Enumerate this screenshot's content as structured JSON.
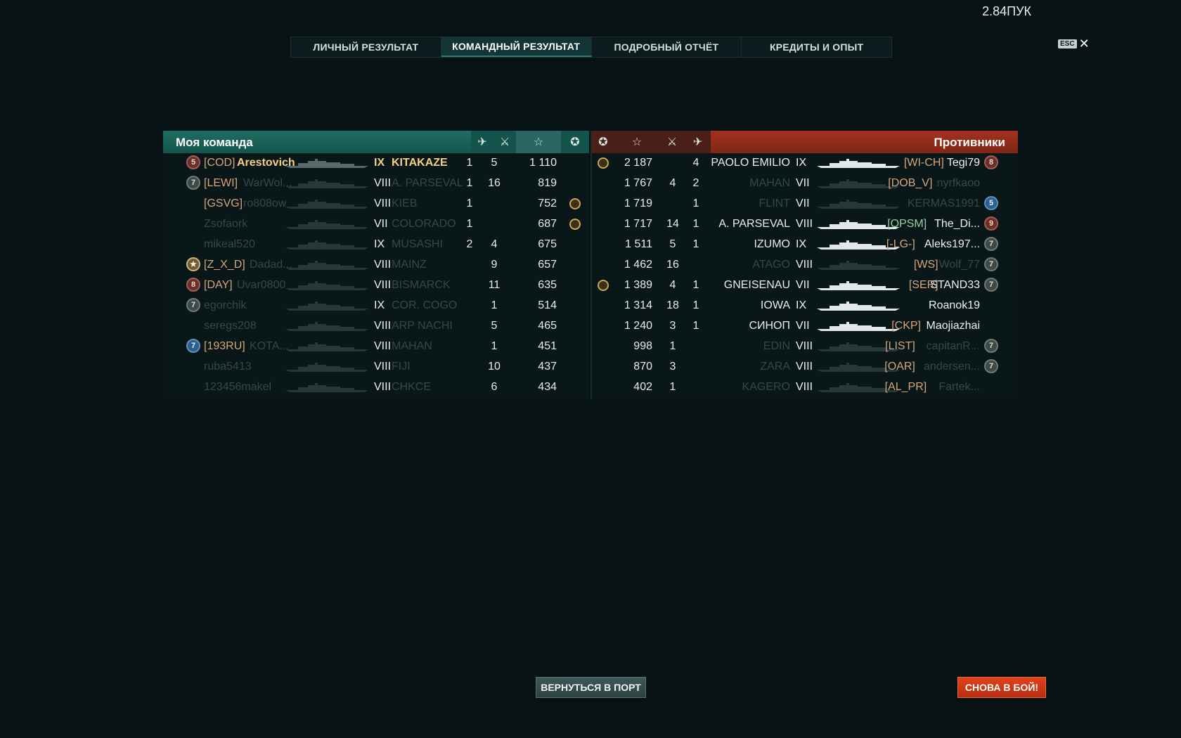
{
  "top_info": "2.84ПУК",
  "tabs": [
    {
      "label": "ЛИЧНЫЙ РЕЗУЛЬТАТ",
      "active": false
    },
    {
      "label": "КОМАНДНЫЙ РЕЗУЛЬТАТ",
      "active": true
    },
    {
      "label": "ПОДРОБНЫЙ ОТЧЁТ",
      "active": false
    },
    {
      "label": "КРЕДИТЫ И ОПЫТ",
      "active": false
    }
  ],
  "esc_label": "ESC",
  "close_glyph": "✕",
  "my_team": {
    "title": "Моя команда",
    "header_icons": {
      "planes": "✈",
      "kills": "⚔",
      "exp": "☆",
      "medal": "✪"
    },
    "rows": [
      {
        "badge": "5",
        "badge_style": "red",
        "clan": "[COD]",
        "name": "Arestovich",
        "tier": "IX",
        "ship": "KITAKAZE",
        "planes": "1",
        "kills": "5",
        "exp": "1 110",
        "medal": false,
        "me": true,
        "dim": false
      },
      {
        "badge": "7",
        "badge_style": "gray",
        "clan": "[LEWI]",
        "name": "WarWol...",
        "tier": "VIII",
        "ship": "A. PARSEVAL",
        "planes": "1",
        "kills": "16",
        "exp": "819",
        "medal": false,
        "me": false,
        "dim": true
      },
      {
        "badge": "",
        "badge_style": "",
        "clan": "[GSVG]",
        "name": "ro808ow",
        "tier": "VIII",
        "ship": "KIEB",
        "planes": "1",
        "kills": "",
        "exp": "752",
        "medal": true,
        "me": false,
        "dim": true
      },
      {
        "badge": "",
        "badge_style": "",
        "clan": "",
        "name": "Zsofaork",
        "tier": "VII",
        "ship": "COLORADO",
        "planes": "1",
        "kills": "",
        "exp": "687",
        "medal": true,
        "me": false,
        "dim": true
      },
      {
        "badge": "",
        "badge_style": "",
        "clan": "",
        "name": "mikeal520",
        "tier": "IX",
        "ship": "MUSASHI",
        "planes": "2",
        "kills": "4",
        "exp": "675",
        "medal": false,
        "me": false,
        "dim": true
      },
      {
        "badge": "★",
        "badge_style": "star",
        "clan": "[Z_X_D]",
        "name": "Dadad...",
        "tier": "VIII",
        "ship": "MAINZ",
        "planes": "",
        "kills": "9",
        "exp": "657",
        "medal": false,
        "me": false,
        "dim": true
      },
      {
        "badge": "8",
        "badge_style": "red",
        "clan": "[DAY]",
        "name": "Uvar0800",
        "tier": "VIII",
        "ship": "BISMARCK",
        "planes": "",
        "kills": "11",
        "exp": "635",
        "medal": false,
        "me": false,
        "dim": true
      },
      {
        "badge": "7",
        "badge_style": "gray",
        "clan": "",
        "name": "egorchik",
        "tier": "IX",
        "ship": "COR. COGO",
        "planes": "",
        "kills": "1",
        "exp": "514",
        "medal": false,
        "me": false,
        "dim": true
      },
      {
        "badge": "",
        "badge_style": "",
        "clan": "",
        "name": "seregs208",
        "tier": "VIII",
        "ship": "ARP NACHI",
        "planes": "",
        "kills": "5",
        "exp": "465",
        "medal": false,
        "me": false,
        "dim": true
      },
      {
        "badge": "7",
        "badge_style": "blue",
        "clan": "[193RU]",
        "name": "KOTA...",
        "tier": "VIII",
        "ship": "MAHAN",
        "planes": "",
        "kills": "1",
        "exp": "451",
        "medal": false,
        "me": false,
        "dim": true
      },
      {
        "badge": "",
        "badge_style": "",
        "clan": "",
        "name": "ruba5413",
        "tier": "VIII",
        "ship": "FIJI",
        "planes": "",
        "kills": "10",
        "exp": "437",
        "medal": false,
        "me": false,
        "dim": true
      },
      {
        "badge": "",
        "badge_style": "",
        "clan": "",
        "name": "123456makel",
        "tier": "VIII",
        "ship": "CHKCE",
        "planes": "",
        "kills": "6",
        "exp": "434",
        "medal": false,
        "me": false,
        "dim": true
      }
    ]
  },
  "enemy_team": {
    "title": "Противники",
    "rows": [
      {
        "medal": true,
        "exp": "2 187",
        "kills": "",
        "planes": "4",
        "ship": "PAOLO EMILIO",
        "tier": "IX",
        "clan": "[WI-CH]",
        "clan_style": "",
        "name": "Tegi79",
        "badge": "8",
        "badge_style": "red",
        "dim": false
      },
      {
        "medal": false,
        "exp": "1 767",
        "kills": "4",
        "planes": "2",
        "ship": "MAHAN",
        "tier": "VII",
        "clan": "[DOB_V]",
        "clan_style": "",
        "name": "nyrfkaoo",
        "badge": "",
        "badge_style": "",
        "dim": true
      },
      {
        "medal": false,
        "exp": "1 719",
        "kills": "",
        "planes": "1",
        "ship": "FLINT",
        "tier": "VII",
        "clan": "",
        "clan_style": "",
        "name": "KERMAS1991",
        "badge": "5",
        "badge_style": "blue",
        "dim": true
      },
      {
        "medal": false,
        "exp": "1 717",
        "kills": "14",
        "planes": "1",
        "ship": "A. PARSEVAL",
        "tier": "VIII",
        "clan": "[OPSM]",
        "clan_style": "green",
        "name": "The_Di...",
        "badge": "9",
        "badge_style": "red",
        "dim": false
      },
      {
        "medal": false,
        "exp": "1 511",
        "kills": "5",
        "planes": "1",
        "ship": "IZUMO",
        "tier": "IX",
        "clan": "[-LG-]",
        "clan_style": "",
        "name": "Aleks197...",
        "badge": "7",
        "badge_style": "gray",
        "dim": false
      },
      {
        "medal": false,
        "exp": "1 462",
        "kills": "16",
        "planes": "",
        "ship": "ATAGO",
        "tier": "VIII",
        "clan": "[WS]",
        "clan_style": "",
        "name": "Wolf_77",
        "badge": "7",
        "badge_style": "gray",
        "dim": true
      },
      {
        "medal": true,
        "exp": "1 389",
        "kills": "4",
        "planes": "1",
        "ship": "GNEISENAU",
        "tier": "VII",
        "clan": "[SER]",
        "clan_style": "",
        "name": "STAND33",
        "badge": "7",
        "badge_style": "gray",
        "dim": false
      },
      {
        "medal": false,
        "exp": "1 314",
        "kills": "18",
        "planes": "1",
        "ship": "IOWA",
        "tier": "IX",
        "clan": "",
        "clan_style": "",
        "name": "Roanok19",
        "badge": "",
        "badge_style": "",
        "dim": false
      },
      {
        "medal": false,
        "exp": "1 240",
        "kills": "3",
        "planes": "1",
        "ship": "СИНОП",
        "tier": "VII",
        "clan": "[CKP]",
        "clan_style": "",
        "name": "Maojiazhai",
        "badge": "",
        "badge_style": "",
        "dim": false
      },
      {
        "medal": false,
        "exp": "998",
        "kills": "1",
        "planes": "",
        "ship": "EDIN",
        "tier": "VIII",
        "clan": "[LIST]",
        "clan_style": "",
        "name": "capitanR...",
        "badge": "7",
        "badge_style": "gray",
        "dim": true
      },
      {
        "medal": false,
        "exp": "870",
        "kills": "3",
        "planes": "",
        "ship": "ZARA",
        "tier": "VIII",
        "clan": "[OAR]",
        "clan_style": "",
        "name": "andersen...",
        "badge": "7",
        "badge_style": "gray",
        "dim": true
      },
      {
        "medal": false,
        "exp": "402",
        "kills": "1",
        "planes": "",
        "ship": "KAGERO",
        "tier": "VIII",
        "clan": "[AL_PR]",
        "clan_style": "",
        "name": "Fartek...",
        "badge": "",
        "badge_style": "",
        "dim": true
      }
    ]
  },
  "buttons": {
    "port": "ВЕРНУТЬСЯ В ПОРТ",
    "fight": "СНОВА В БОЙ!"
  }
}
